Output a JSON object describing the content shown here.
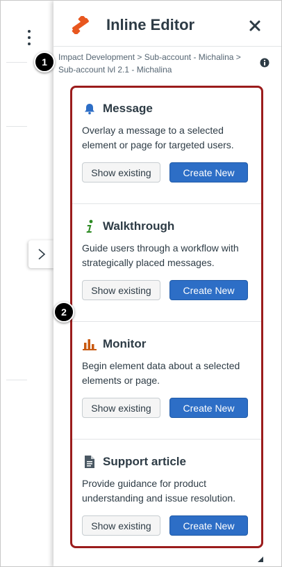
{
  "panel": {
    "title": "Inline Editor",
    "breadcrumb": "Impact Development > Sub-account - Michalina > Sub-account lvl 2.1 - Michalina"
  },
  "callouts": {
    "one": "1",
    "two": "2"
  },
  "cards": [
    {
      "icon": "bell-icon",
      "title": "Message",
      "description": "Overlay a message to a selected element or page for targeted users.",
      "show_label": "Show existing",
      "create_label": "Create New"
    },
    {
      "icon": "info-italic-icon",
      "title": "Walkthrough",
      "description": "Guide users through a workflow with strategically placed messages.",
      "show_label": "Show existing",
      "create_label": "Create New"
    },
    {
      "icon": "bar-chart-icon",
      "title": "Monitor",
      "description": "Begin element data about a selected elements or page.",
      "show_label": "Show existing",
      "create_label": "Create New"
    },
    {
      "icon": "document-icon",
      "title": "Support article",
      "description": "Provide guidance for product understanding and issue resolution.",
      "show_label": "Show existing",
      "create_label": "Create New"
    }
  ],
  "colors": {
    "accent_blue": "#2d6ec6",
    "highlight_border": "#9b1c1c",
    "logo_orange": "#e8571f",
    "walkthrough_green": "#2d8a23",
    "monitor_orange": "#c85a12",
    "text_dark": "#2d3b45"
  }
}
